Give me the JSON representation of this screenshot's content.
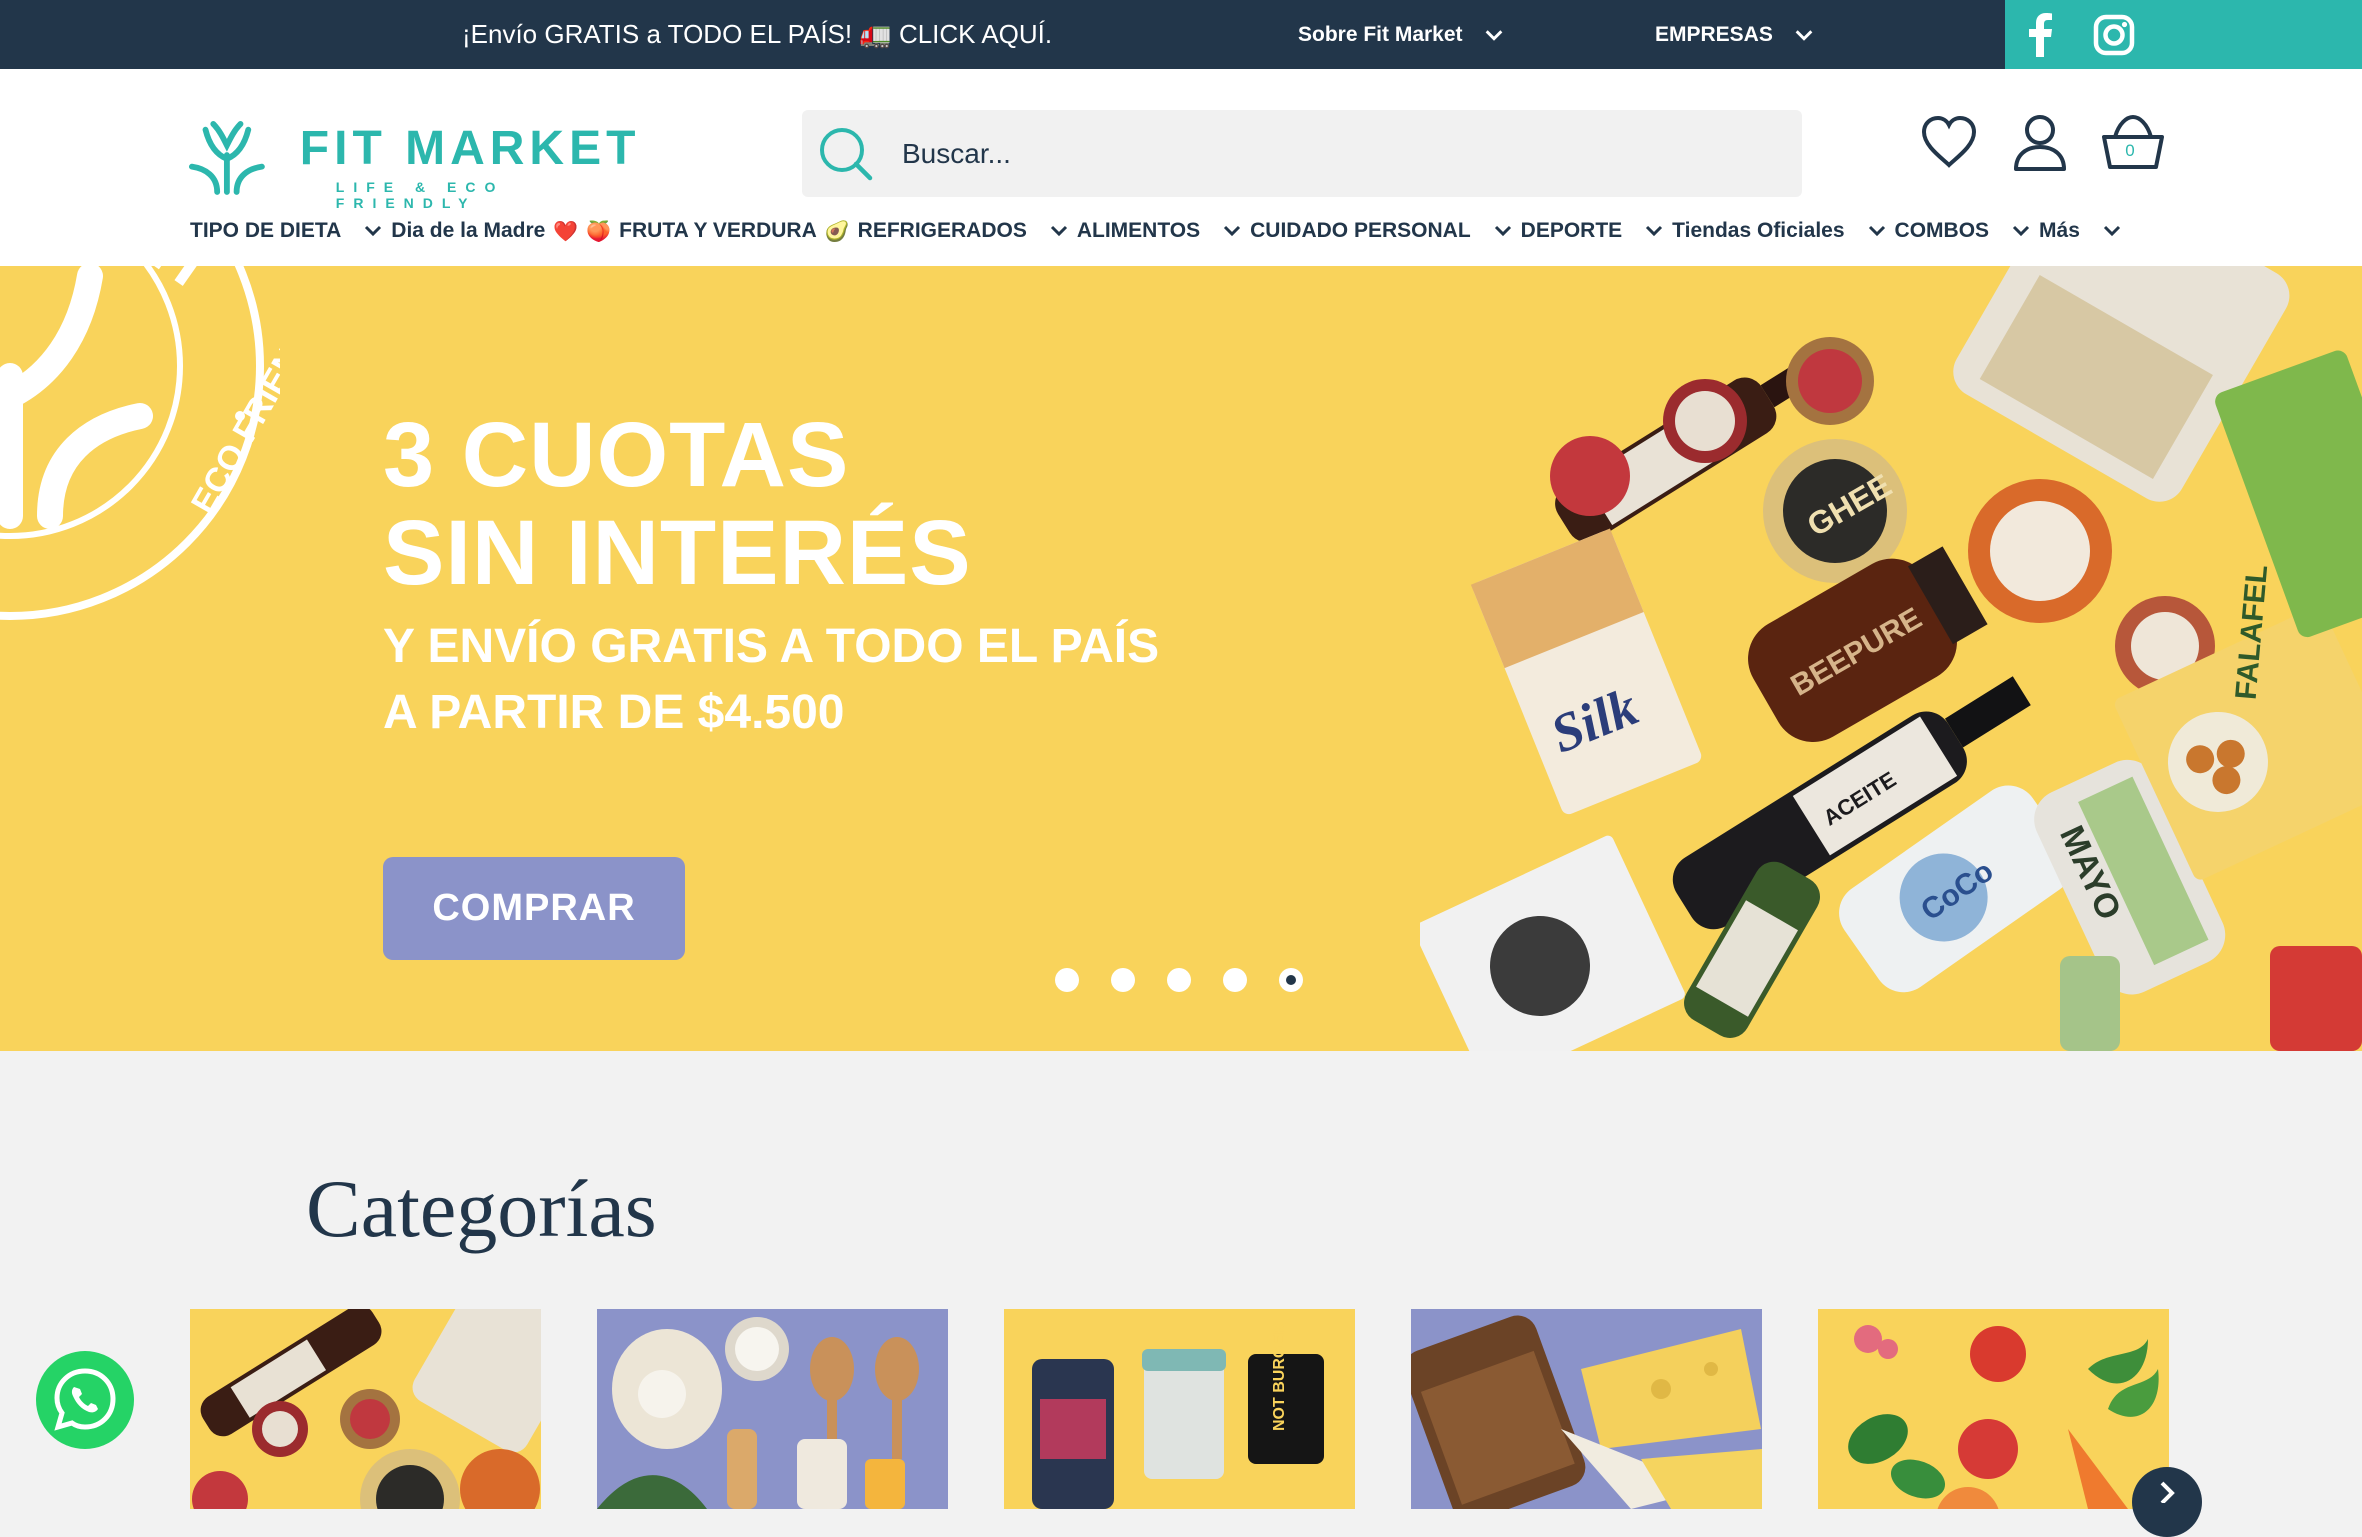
{
  "topbar": {
    "promo": "¡Envío GRATIS a TODO EL PAÍS! 🚛 CLICK AQUÍ.",
    "about": "Sobre Fit Market",
    "business": "EMPRESAS",
    "social": [
      "facebook-icon",
      "instagram-icon"
    ]
  },
  "header": {
    "logo_title": "FIT MARKET",
    "logo_sub": "LIFE & ECO FRIENDLY",
    "search_placeholder": "Buscar...",
    "cart_count": "0",
    "icons": [
      "heart-icon",
      "user-icon",
      "basket-icon"
    ]
  },
  "nav": {
    "items": [
      {
        "label": "TIPO DE DIETA"
      },
      {
        "label": "Dia de la Madre",
        "emoji": "❤️"
      },
      {
        "label": "FRUTA Y VERDURA",
        "emoji_before": "🍑",
        "emoji": "🥑"
      },
      {
        "label": "REFRIGERADOS"
      },
      {
        "label": "ALIMENTOS"
      },
      {
        "label": "CUIDADO PERSONAL"
      },
      {
        "label": "DEPORTE"
      },
      {
        "label": "Tiendas Oficiales"
      },
      {
        "label": "COMBOS"
      },
      {
        "label": "Más"
      }
    ]
  },
  "hero": {
    "line1": "3 CUOTAS",
    "line2": "SIN INTERÉS",
    "sub1": "Y ENVÍO GRATIS A TODO EL PAÍS",
    "sub2": "A PARTIR DE $4.500",
    "button": "COMPRAR",
    "slides": 5,
    "active_slide": 5,
    "emblem_text": "FIT MARKET · LIFE & ECO FRIENDLY",
    "colors": {
      "background": "#f9d35b",
      "button": "#8b93c9"
    }
  },
  "categories": {
    "title": "Categorías",
    "cards": 5
  },
  "colors": {
    "navy": "#22364a",
    "teal": "#2cb7ad",
    "whatsapp": "#25d366"
  }
}
